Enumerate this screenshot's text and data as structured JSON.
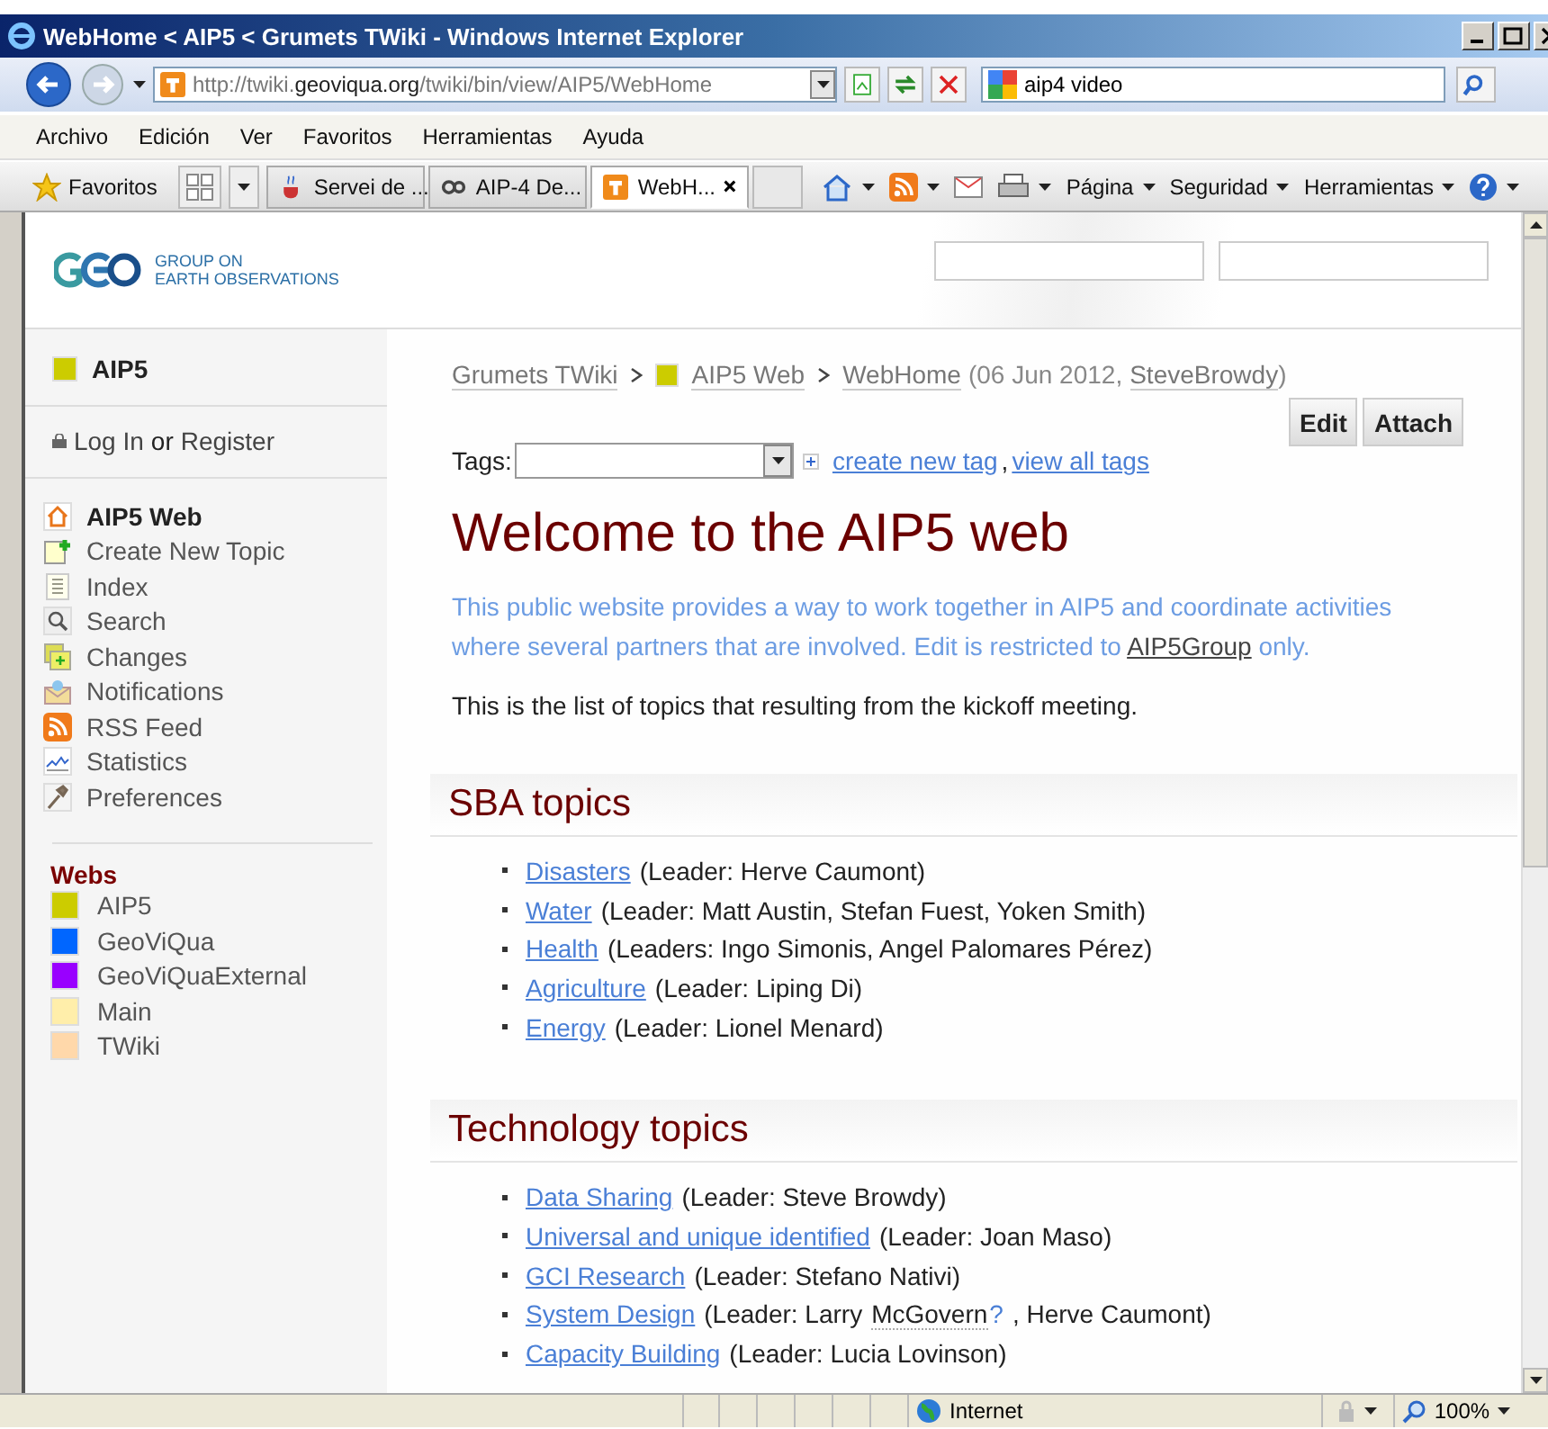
{
  "window": {
    "title": "WebHome < AIP5 < Grumets TWiki - Windows Internet Explorer"
  },
  "address_bar": {
    "prefix": "http://twiki.",
    "domain": "geoviqua.org",
    "path": "/twiki/bin/view/AIP5/WebHome"
  },
  "search_box": {
    "value": "aip4 video"
  },
  "menu": [
    "Archivo",
    "Edición",
    "Ver",
    "Favoritos",
    "Herramientas",
    "Ayuda"
  ],
  "favorites_bar": {
    "favorites": "Favoritos",
    "tabs": [
      {
        "label": "Servei de ...",
        "kind": "java",
        "selected": false
      },
      {
        "label": "AIP-4 De...",
        "kind": "gear",
        "selected": false
      },
      {
        "label": "WebH...",
        "kind": "twiki",
        "selected": true
      }
    ],
    "commands": [
      "Página",
      "Seguridad",
      "Herramientas"
    ]
  },
  "header": {
    "logo_lines": [
      "GROUP ON",
      "EARTH OBSERVATIONS"
    ]
  },
  "sidebar": {
    "web": {
      "name": "AIP5",
      "color": "#cccc00"
    },
    "login": {
      "log_in": "Log In",
      "or": "or",
      "register": "Register"
    },
    "items": [
      {
        "label": "AIP5 Web",
        "kind": "home",
        "selected": true
      },
      {
        "label": "Create New Topic",
        "kind": "create",
        "selected": false
      },
      {
        "label": "Index",
        "kind": "index",
        "selected": false
      },
      {
        "label": "Search",
        "kind": "search",
        "selected": false
      },
      {
        "label": "Changes",
        "kind": "changes",
        "selected": false
      },
      {
        "label": "Notifications",
        "kind": "notifications",
        "selected": false
      },
      {
        "label": "RSS Feed",
        "kind": "rss",
        "selected": false
      },
      {
        "label": "Statistics",
        "kind": "statistics",
        "selected": false
      },
      {
        "label": "Preferences",
        "kind": "preferences",
        "selected": false
      }
    ],
    "webs_heading": "Webs",
    "webs": [
      {
        "name": "AIP5",
        "color": "#cccc00"
      },
      {
        "name": "GeoViQua",
        "color": "#0066ff"
      },
      {
        "name": "GeoViQuaExternal",
        "color": "#9900ff"
      },
      {
        "name": "Main",
        "color": "#ffeeaa"
      },
      {
        "name": "TWiki",
        "color": "#ffd8aa"
      }
    ]
  },
  "breadcrumb": {
    "items": [
      {
        "label": "Grumets TWiki"
      },
      {
        "label": "AIP5 Web",
        "color": "#cccc00"
      },
      {
        "label": "WebHome"
      }
    ],
    "date": "(06 Jun 2012,",
    "author": "SteveBrowdy",
    "close": ")"
  },
  "buttons": [
    "Edit",
    "Attach"
  ],
  "tags": {
    "label": "Tags:",
    "create": "create new tag",
    "separator": ",",
    "view_all": "view all tags"
  },
  "title": "Welcome to the AIP5 web",
  "intro": {
    "before": "This public website provides a way to work together in AIP5 and coordinate activities where several partners that are involved. Edit is restricted to",
    "link": "AIP5Group",
    "after": "only."
  },
  "lead": "This is the list of topics that resulting from the kickoff meeting.",
  "sections": [
    {
      "heading": "SBA topics",
      "items": [
        {
          "parts": [
            {
              "kind": "link",
              "text": "Disasters"
            },
            {
              "kind": "text",
              "text": "(Leader: Herve Caumont)"
            }
          ]
        },
        {
          "parts": [
            {
              "kind": "link",
              "text": "Water"
            },
            {
              "kind": "text",
              "text": "(Leader: Matt Austin, Stefan Fuest, Yoken Smith)"
            }
          ]
        },
        {
          "parts": [
            {
              "kind": "link",
              "text": "Health"
            },
            {
              "kind": "text",
              "text": "(Leaders: Ingo Simonis, Angel Palomares Pérez)"
            }
          ]
        },
        {
          "parts": [
            {
              "kind": "link",
              "text": "Agriculture"
            },
            {
              "kind": "text",
              "text": "(Leader: Liping Di)"
            }
          ]
        },
        {
          "parts": [
            {
              "kind": "link",
              "text": "Energy"
            },
            {
              "kind": "text",
              "text": "(Leader: Lionel Menard)"
            }
          ]
        }
      ]
    },
    {
      "heading": "Technology topics",
      "items": [
        {
          "parts": [
            {
              "kind": "link",
              "text": "Data Sharing"
            },
            {
              "kind": "text",
              "text": "(Leader: Steve Browdy)"
            }
          ]
        },
        {
          "parts": [
            {
              "kind": "link",
              "text": "Universal and unique identified"
            },
            {
              "kind": "text",
              "text": "(Leader: Joan Maso)"
            }
          ]
        },
        {
          "parts": [
            {
              "kind": "link",
              "text": "GCI Research"
            },
            {
              "kind": "text",
              "text": "(Leader: Stefano Nativi)"
            }
          ]
        },
        {
          "parts": [
            {
              "kind": "link",
              "text": "System Design"
            },
            {
              "kind": "text",
              "text": "(Leader: Larry"
            },
            {
              "kind": "missing",
              "text": "McGovern"
            },
            {
              "kind": "create",
              "text": "?"
            },
            {
              "kind": "text",
              "text": ", Herve Caumont)"
            }
          ]
        },
        {
          "parts": [
            {
              "kind": "link",
              "text": "Capacity Building"
            },
            {
              "kind": "text",
              "text": "(Leader: Lucia Lovinson)"
            }
          ]
        }
      ]
    }
  ],
  "status_bar": {
    "zone": "Internet",
    "zoom": "100%"
  }
}
